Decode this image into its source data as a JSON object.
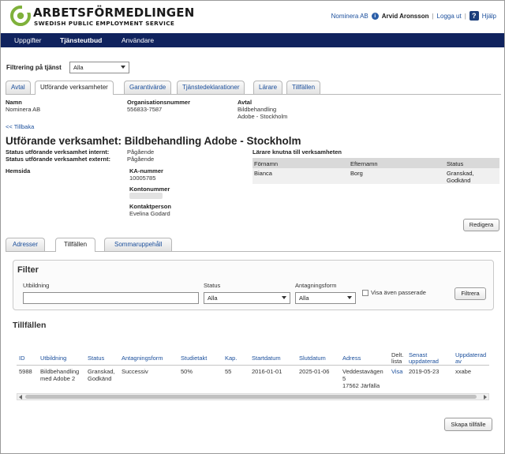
{
  "header": {
    "brand": "ARBETSFÖRMEDLINGEN",
    "brand_sub": "SWEDISH PUBLIC EMPLOYMENT SERVICE",
    "org": "Nominera AB",
    "user": "Arvid Aronsson",
    "logout": "Logga ut",
    "help": "Hjälp",
    "info_glyph": "i",
    "help_glyph": "?",
    "sep": "|"
  },
  "nav": {
    "items": [
      "Uppgifter",
      "Tjänsteutbud",
      "Användare"
    ],
    "active": 1
  },
  "filter": {
    "label": "Filtrering på tjänst",
    "value": "Alla"
  },
  "tabs": [
    "Avtal",
    "Utförande verksamheter",
    "Garantivärde",
    "Tjänstedeklarationer",
    "Lärare",
    "Tillfällen"
  ],
  "info": {
    "name_label": "Namn",
    "name": "Nominera AB",
    "orgnr_label": "Organisationsnummer",
    "orgnr": "556833-7587",
    "avtal_label": "Avtal",
    "avtal_1": "Bildbehandling",
    "avtal_2": "Adobe - Stockholm"
  },
  "back_link": "<< Tillbaka",
  "title": "Utförande verksamhet: Bildbehandling Adobe - Stockholm",
  "status": {
    "internal_label": "Status utförande verksamhet internt:",
    "internal": "Pågående",
    "external_label": "Status utförande verksamhet externt:",
    "external": "Pågående",
    "homepage_label": "Hemsida",
    "ka_label": "KA-nummer",
    "ka": "10005785",
    "konto_label": "Kontonummer",
    "kontakt_label": "Kontaktperson",
    "kontakt": "Evelina Godard"
  },
  "teachers": {
    "title": "Lärare knutna till verksamheten",
    "headers": [
      "Förnamn",
      "Efternamn",
      "Status"
    ],
    "rows": [
      [
        "Bianca",
        "Borg",
        "Granskad,",
        "Godkänd"
      ]
    ]
  },
  "edit_button": "Redigera",
  "subtabs": [
    "Adresser",
    "Tillfällen",
    "Sommaruppehåll"
  ],
  "filter_panel": {
    "title": "Filter",
    "utbildning_label": "Utbildning",
    "status_label": "Status",
    "status_value": "Alla",
    "antagning_label": "Antagningsform",
    "antagning_value": "Alla",
    "passed_label": "Visa även passerade",
    "button": "Filtrera"
  },
  "occasions": {
    "title": "Tillfällen",
    "headers": [
      "ID",
      "Utbildning",
      "Status",
      "Antagningsform",
      "Studietakt",
      "Kap.",
      "Startdatum",
      "Slutdatum",
      "Adress",
      "Delt.",
      "lista",
      "Senast",
      "uppdaterad",
      "Uppdaterad",
      "av"
    ],
    "row": {
      "id": "5988",
      "utbildning_1": "Bildbehandling",
      "utbildning_2": "med Adobe 2",
      "status_1": "Granskad,",
      "status_2": "Godkänd",
      "antagning": "Successiv",
      "takt": "50%",
      "kap": "55",
      "start": "2016-01-01",
      "slut": "2025-01-06",
      "adress_1": "Veddestavägen",
      "adress_2": "5",
      "adress_3": "17562 Järfälla",
      "lista": "Visa",
      "senast": "2019-05-23",
      "av": "xxabe"
    }
  },
  "create_button": "Skapa tillfälle",
  "colors": {
    "nav_bg": "#10235e",
    "logo_green": "#7fb13b",
    "link": "#1b4f9c"
  }
}
